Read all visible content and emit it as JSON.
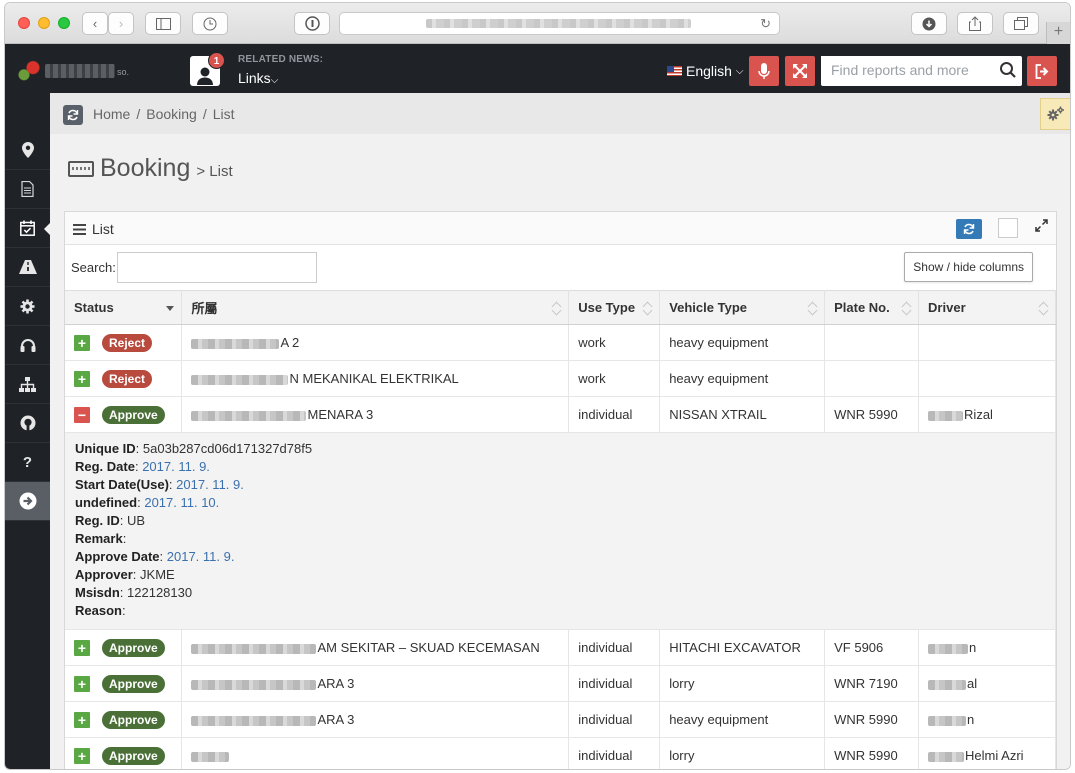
{
  "browser": {
    "nav_back": "‹",
    "nav_forward": "›",
    "reload": "↻",
    "new_tab": "+"
  },
  "header": {
    "news_badge": "1",
    "news_title": "RELATED NEWS:",
    "news_links": "Links",
    "language": "English",
    "search_placeholder": "Find reports and more",
    "logo_suffix": "so."
  },
  "breadcrumb": {
    "items": [
      "Home",
      "Booking",
      "List"
    ],
    "separator": "/"
  },
  "page": {
    "title": "Booking",
    "subtitle": "> List"
  },
  "panel": {
    "title": "List",
    "search_label": "Search:",
    "search_value": "",
    "colvis_label": "Show / hide columns"
  },
  "table": {
    "columns": [
      "Status",
      "所屬",
      "Use Type",
      "Vehicle Type",
      "Plate No.",
      "Driver"
    ],
    "rows": [
      {
        "ctl": "+",
        "status": "Reject",
        "status_color": "#b84a3e",
        "affiliation": "A 2",
        "use_type": "work",
        "vehicle_type": "heavy equipment",
        "plate_no": "",
        "driver": ""
      },
      {
        "ctl": "+",
        "status": "Reject",
        "status_color": "#b84a3e",
        "affiliation": "N MEKANIKAL ELEKTRIKAL",
        "use_type": "work",
        "vehicle_type": "heavy equipment",
        "plate_no": "",
        "driver": ""
      },
      {
        "ctl": "−",
        "status": "Approve",
        "status_color": "#4a7038",
        "affiliation": "MENARA 3",
        "use_type": "individual",
        "vehicle_type": "NISSAN XTRAIL",
        "plate_no": "WNR 5990",
        "driver": "Rizal"
      },
      {
        "ctl": "+",
        "status": "Approve",
        "status_color": "#4a7038",
        "affiliation": "AM SEKITAR – SKUAD KECEMASAN",
        "use_type": "individual",
        "vehicle_type": "HITACHI EXCAVATOR",
        "plate_no": "VF 5906",
        "driver": "n"
      },
      {
        "ctl": "+",
        "status": "Approve",
        "status_color": "#4a7038",
        "affiliation": "ARA 3",
        "use_type": "individual",
        "vehicle_type": "lorry",
        "plate_no": "WNR 7190",
        "driver": "al"
      },
      {
        "ctl": "+",
        "status": "Approve",
        "status_color": "#4a7038",
        "affiliation": "ARA 3",
        "use_type": "individual",
        "vehicle_type": "heavy equipment",
        "plate_no": "WNR 5990",
        "driver": "n"
      },
      {
        "ctl": "+",
        "status": "Approve",
        "status_color": "#4a7038",
        "affiliation": "",
        "use_type": "individual",
        "vehicle_type": "lorry",
        "plate_no": "WNR 5990",
        "driver": "Helmi Azri"
      }
    ],
    "detail": {
      "unique_id_label": "Unique ID",
      "unique_id": "5a03b287cd06d171327d78f5",
      "reg_date_label": "Reg. Date",
      "reg_date": "2017. 11. 9.",
      "start_date_label": "Start Date(Use)",
      "start_date": "2017. 11. 9.",
      "undefined_label": "undefined",
      "undefined_value": "2017. 11. 10.",
      "reg_id_label": "Reg. ID",
      "reg_id": "UB",
      "remark_label": "Remark",
      "remark": "",
      "approve_date_label": "Approve Date",
      "approve_date": "2017. 11. 9.",
      "approver_label": "Approver",
      "approver": "JKME",
      "msisdn_label": "Msisdn",
      "msisdn": "122128130",
      "reason_label": "Reason",
      "reason": ""
    }
  },
  "colors": {
    "header_bg": "#1f2328",
    "danger": "#d9534f",
    "primary": "#337ab7",
    "plus": "#5aa843"
  },
  "icons": {
    "sidebar": [
      "map-marker-icon",
      "document-icon",
      "calendar-check-icon",
      "road-icon",
      "gear-icon",
      "headset-icon",
      "sitemap-icon",
      "github-icon",
      "question-icon",
      "arrow-circle-right-icon"
    ]
  }
}
